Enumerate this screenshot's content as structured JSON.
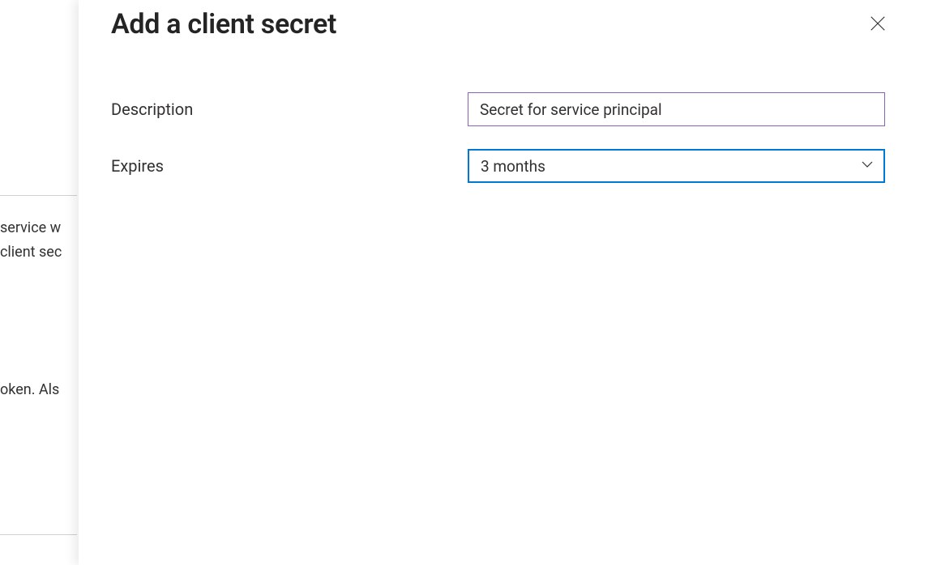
{
  "background": {
    "line1": "service w",
    "line2": "client sec",
    "line3": "oken. Als"
  },
  "panel": {
    "title": "Add a client secret",
    "form": {
      "description_label": "Description",
      "description_value": "Secret for service principal",
      "expires_label": "Expires",
      "expires_value": "3 months"
    }
  }
}
